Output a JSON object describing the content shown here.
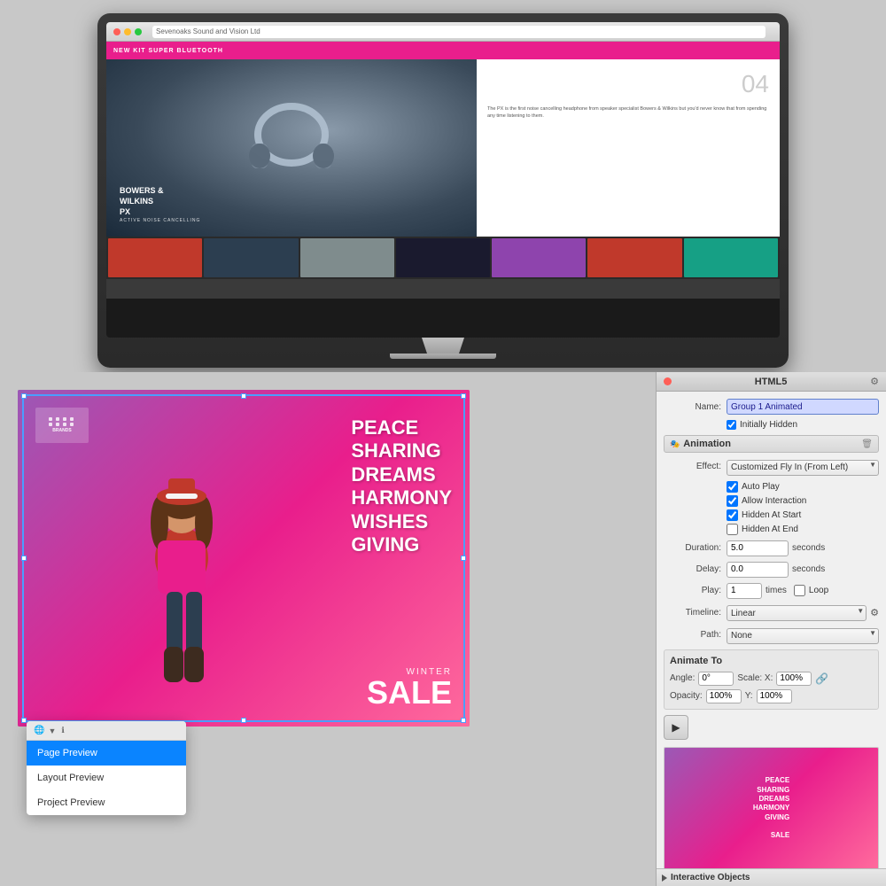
{
  "imac": {
    "browser": {
      "url": "Sevenoaks Sound and Vision Ltd",
      "tab_label": "Sevenoaks Sound and Vision Ltd"
    },
    "magazine": {
      "header": "NEW KIT SUPER BLUETOOTH",
      "bowers_line1": "BOWERS &",
      "bowers_line2": "WILKINS",
      "bowers_line3": "PX",
      "bowers_sub": "ACTIVE NOISE CANCELLING",
      "page_number": "04",
      "description": "The PX is the first noise cancelling headphone from speaker specialist Bowers & Wilkins but you'd never know that from spending any time listening to them."
    }
  },
  "canvas": {
    "overlay_text": "PEACE\nSHARING\nDREAMS\nHARMONY\nWISHES\nGIVING",
    "winter": "WINTER",
    "sale": "SALE"
  },
  "dropdown": {
    "header_icon": "🌐",
    "items": [
      {
        "label": "Page Preview",
        "selected": true
      },
      {
        "label": "Layout Preview",
        "selected": false
      },
      {
        "label": "Project Preview",
        "selected": false
      }
    ]
  },
  "inspector": {
    "title": "HTML5",
    "name_label": "Name:",
    "name_value": "Group 1 Animated",
    "initially_hidden_label": "Initially Hidden",
    "initially_hidden_checked": true,
    "animation_section": "Animation",
    "effect_label": "Effect:",
    "effect_value": "Customized Fly In (From Left)",
    "checkboxes": [
      {
        "label": "Auto Play",
        "checked": true
      },
      {
        "label": "Allow Interaction",
        "checked": true
      },
      {
        "label": "Hidden At Start",
        "checked": true
      },
      {
        "label": "Hidden At End",
        "checked": false
      }
    ],
    "duration_label": "Duration:",
    "duration_value": "5.0 seconds",
    "delay_label": "Delay:",
    "delay_value": "0.0 seconds",
    "play_label": "Play:",
    "play_value": "1 times",
    "loop_label": "Loop",
    "loop_checked": false,
    "timeline_label": "Timeline:",
    "timeline_value": "Linear",
    "path_label": "Path:",
    "path_value": "None",
    "animate_to": {
      "title": "Animate To",
      "angle_label": "Angle:",
      "angle_value": "0°",
      "scale_x_label": "Scale: X:",
      "scale_x_value": "100%",
      "opacity_label": "Opacity:",
      "opacity_value": "100%",
      "y_label": "Y:",
      "y_value": "100%"
    },
    "interactive_objects_label": "Interactive Objects",
    "play_btn_label": "▶"
  }
}
